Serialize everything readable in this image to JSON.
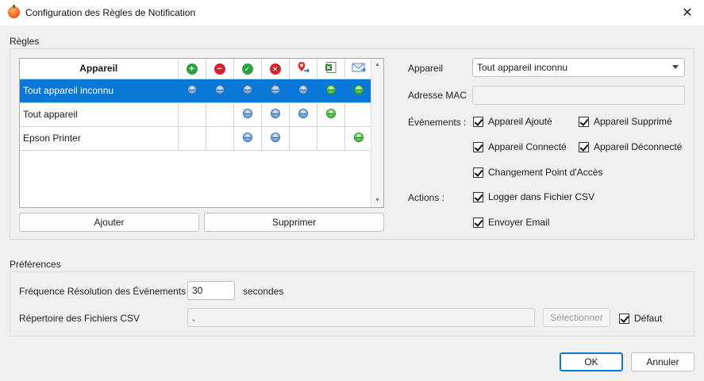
{
  "window": {
    "title": "Configuration des Règles de Notification",
    "close_glyph": "✕"
  },
  "rules": {
    "section_label": "Règles",
    "table": {
      "header_device": "Appareil",
      "header_icons": [
        "add-icon",
        "remove-icon",
        "connected-icon",
        "disconnected-icon",
        "location-change-icon",
        "csv-log-icon",
        "email-icon"
      ],
      "rows": [
        {
          "name": "Tout appareil inconnu",
          "selected": true,
          "cells": [
            "blue",
            "blue",
            "blue",
            "blue",
            "blue",
            "green",
            "green"
          ]
        },
        {
          "name": "Tout appareil",
          "selected": false,
          "cells": [
            "",
            "",
            "blue",
            "blue",
            "blue",
            "green",
            ""
          ]
        },
        {
          "name": "Epson Printer",
          "selected": false,
          "cells": [
            "",
            "",
            "blue",
            "blue",
            "",
            "",
            "green"
          ]
        }
      ]
    },
    "add_button": "Ajouter",
    "delete_button": "Supprimer"
  },
  "details": {
    "device_label": "Appareil",
    "device_value": "Tout appareil inconnu",
    "mac_label": "Adresse MAC",
    "mac_value": "",
    "events_label": "Événements :",
    "events": {
      "added": "Appareil Ajouté",
      "removed": "Appareil Supprimé",
      "connected": "Appareil Connecté",
      "disconnected": "Appareil Déconnecté",
      "ap_change": "Changement Point d'Accès"
    },
    "actions_label": "Actions :",
    "actions": {
      "csv": "Logger dans Fichier CSV",
      "email": "Envoyer Email"
    }
  },
  "preferences": {
    "section_label": "Préférences",
    "frequency_label": "Fréquence Résolution des Événements",
    "frequency_value": "30",
    "frequency_unit": "secondes",
    "csv_dir_label": "Répertoire des Fichiers CSV",
    "csv_dir_value": ".",
    "select_button": "Sélectionner",
    "default_checkbox": "Défaut"
  },
  "footer": {
    "ok_button": "OK",
    "cancel_button": "Annuler"
  },
  "colors": {
    "selection": "#0a78d7",
    "dot_blue": "#4a86c7",
    "dot_green": "#2f9e2a"
  }
}
